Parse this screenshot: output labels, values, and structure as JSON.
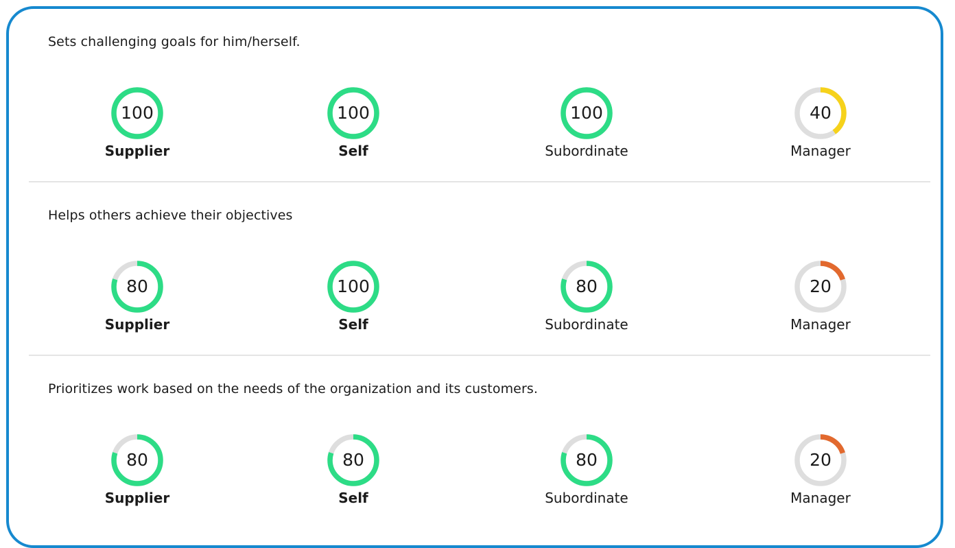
{
  "colors": {
    "frame": "#1689cf",
    "track": "#dedede",
    "high": "#2ddc86",
    "medium": "#f6d21b",
    "low": "#e2692e"
  },
  "questions": [
    {
      "text": "Sets challenging goals for him/herself.",
      "scores": [
        {
          "rater": "Supplier",
          "value": 100,
          "level": "high"
        },
        {
          "rater": "Self",
          "value": 100,
          "level": "high"
        },
        {
          "rater": "Subordinate",
          "value": 100,
          "level": "high"
        },
        {
          "rater": "Manager",
          "value": 40,
          "level": "medium"
        }
      ]
    },
    {
      "text": "Helps others achieve their objectives",
      "scores": [
        {
          "rater": "Supplier",
          "value": 80,
          "level": "high"
        },
        {
          "rater": "Self",
          "value": 100,
          "level": "high"
        },
        {
          "rater": "Subordinate",
          "value": 80,
          "level": "high"
        },
        {
          "rater": "Manager",
          "value": 20,
          "level": "low"
        }
      ]
    },
    {
      "text": "Prioritizes work based on the needs of the organization and its customers.",
      "scores": [
        {
          "rater": "Supplier",
          "value": 80,
          "level": "high"
        },
        {
          "rater": "Self",
          "value": 80,
          "level": "high"
        },
        {
          "rater": "Subordinate",
          "value": 80,
          "level": "high"
        },
        {
          "rater": "Manager",
          "value": 20,
          "level": "low"
        }
      ]
    }
  ]
}
